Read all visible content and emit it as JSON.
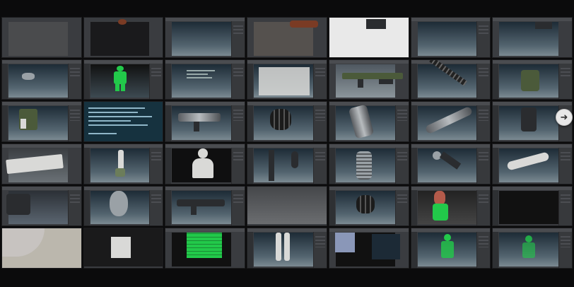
{
  "gallery": {
    "rows": 6,
    "columns": 7,
    "next_icon": "arrow-right-icon",
    "next_symbol": "➜",
    "accent_green": "#22c94a",
    "viewport_top": "#1d2b36",
    "viewport_bottom": "#7b8a92"
  }
}
